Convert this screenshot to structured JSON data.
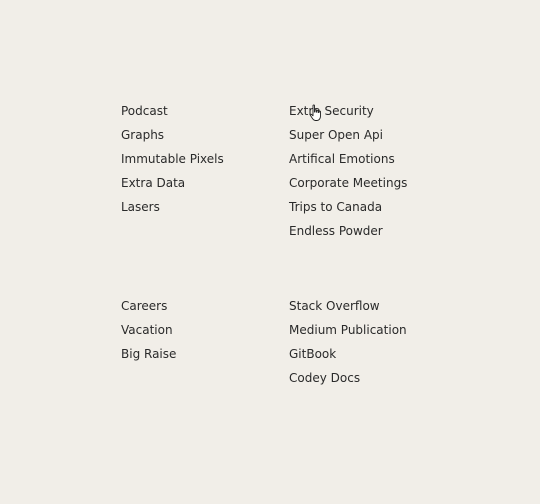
{
  "sections": [
    {
      "heading": "",
      "items": [
        "Podcast",
        "Graphs",
        "Immutable Pixels",
        "Extra Data",
        "Lasers"
      ]
    },
    {
      "heading": "",
      "items": [
        "Extra Security",
        "Super Open Api",
        "Artifical Emotions",
        "Corporate Meetings",
        "Trips to Canada",
        "Endless Powder"
      ]
    },
    {
      "heading": "",
      "items": [
        "Careers",
        "Vacation",
        "Big Raise"
      ]
    },
    {
      "heading": "",
      "items": [
        "Stack Overflow",
        "Medium Publication",
        "GitBook",
        "Codey Docs"
      ]
    }
  ],
  "colors": {
    "background": "#f1eee8",
    "text": "#2a2a2a"
  },
  "cursor": "hand-pointer-icon"
}
